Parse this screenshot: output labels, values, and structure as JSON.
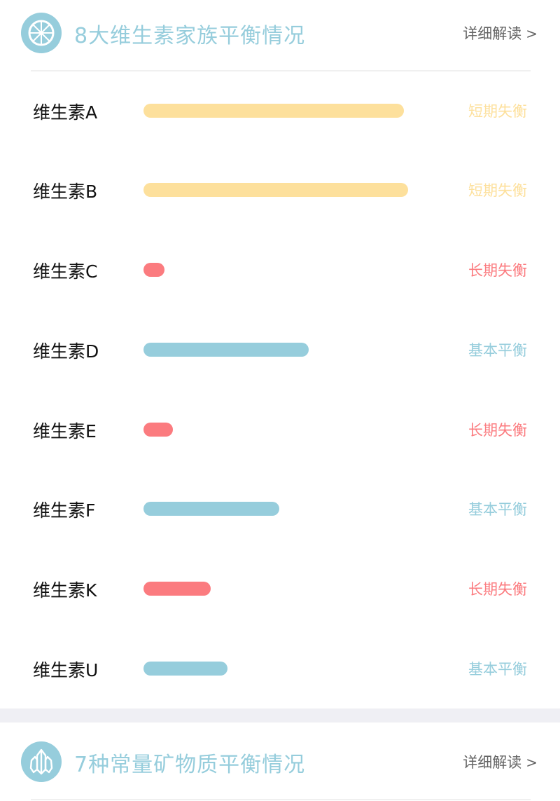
{
  "colors": {
    "accent": "#96cddc",
    "short_term": "#fde09c",
    "long_term": "#fb7b7f",
    "balanced": "#96cddc",
    "label_text": "#111111",
    "link_text": "#666666",
    "separator": "#efeff4"
  },
  "vitamins_section": {
    "icon": "wheel-icon",
    "title": "8大维生素家族平衡情况",
    "detail_link": "详细解读",
    "detail_chevron": ">",
    "rows": [
      {
        "label": "维生素A",
        "level": 0.93,
        "status": "短期失衡",
        "status_key": "short_term"
      },
      {
        "label": "维生素B",
        "level": 0.945,
        "status": "短期失衡",
        "status_key": "short_term"
      },
      {
        "label": "维生素C",
        "level": 0.075,
        "status": "长期失衡",
        "status_key": "long_term"
      },
      {
        "label": "维生素D",
        "level": 0.59,
        "status": "基本平衡",
        "status_key": "balanced"
      },
      {
        "label": "维生素E",
        "level": 0.105,
        "status": "长期失衡",
        "status_key": "long_term"
      },
      {
        "label": "维生素F",
        "level": 0.485,
        "status": "基本平衡",
        "status_key": "balanced"
      },
      {
        "label": "维生素K",
        "level": 0.24,
        "status": "长期失衡",
        "status_key": "long_term"
      },
      {
        "label": "维生素U",
        "level": 0.3,
        "status": "基本平衡",
        "status_key": "balanced"
      }
    ]
  },
  "minerals_section": {
    "icon": "crystal-icon",
    "title": "7种常量矿物质平衡情况",
    "detail_link": "详细解读",
    "detail_chevron": ">"
  }
}
